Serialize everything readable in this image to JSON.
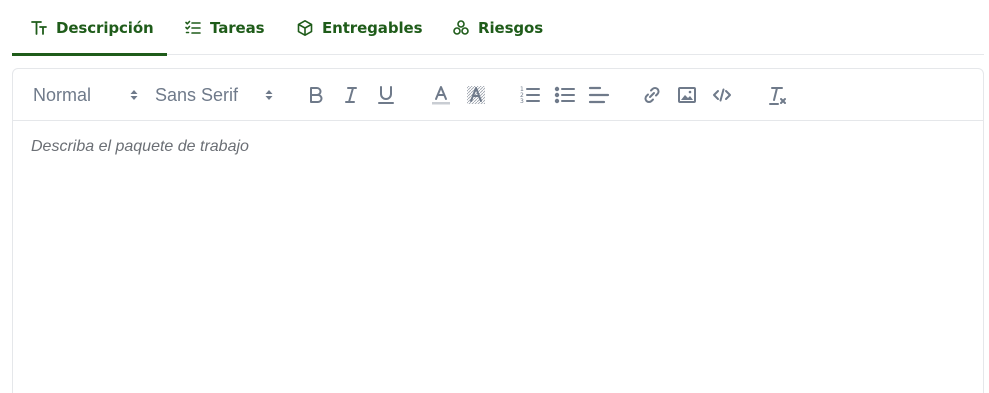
{
  "tabs": [
    {
      "label": "Descripción",
      "icon": "text-size-icon",
      "active": true
    },
    {
      "label": "Tareas",
      "icon": "checklist-icon",
      "active": false
    },
    {
      "label": "Entregables",
      "icon": "box-icon",
      "active": false
    },
    {
      "label": "Riesgos",
      "icon": "clover-icon",
      "active": false
    }
  ],
  "toolbar": {
    "header_value": "Normal",
    "font_value": "Sans Serif",
    "buttons": [
      "bold-icon",
      "italic-icon",
      "underline-icon",
      "text-color-icon",
      "background-color-icon",
      "ordered-list-icon",
      "bullet-list-icon",
      "align-left-icon",
      "link-icon",
      "image-icon",
      "code-icon",
      "clear-format-icon"
    ]
  },
  "editor": {
    "placeholder": "Describa el paquete de trabajo"
  },
  "colors": {
    "accent": "#1f5c1a",
    "toolbar_icon": "#6f7a8a",
    "border": "#e5e7ea"
  }
}
